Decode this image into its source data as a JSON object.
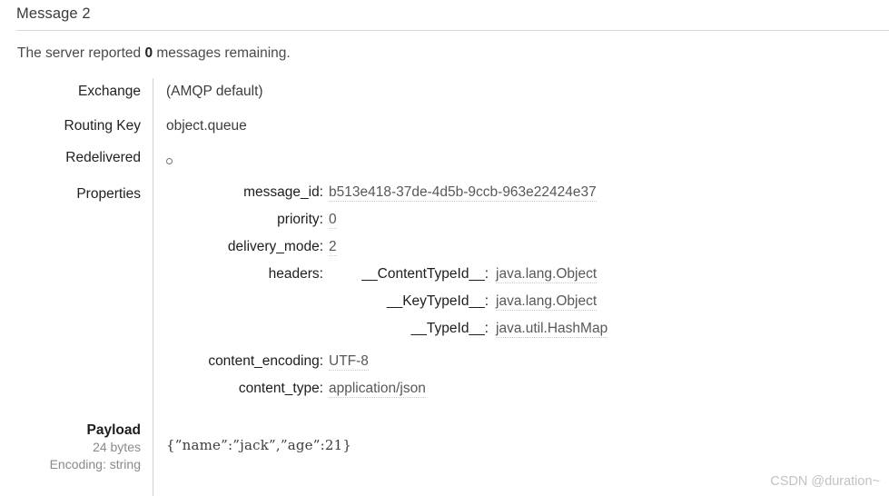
{
  "header": {
    "title": "Message 2"
  },
  "summary": {
    "prefix": "The server reported",
    "count": "0",
    "suffix": "messages remaining."
  },
  "fields": [
    {
      "label": "Exchange",
      "value": "(AMQP default)"
    },
    {
      "label": "Routing Key",
      "value": "object.queue"
    },
    {
      "label": "Redelivered",
      "value": ""
    }
  ],
  "properties": {
    "label": "Properties",
    "items": [
      {
        "key": "message_id:",
        "value": "b513e418-37de-4d5b-9ccb-963e22424e37"
      },
      {
        "key": "priority:",
        "value": "0"
      },
      {
        "key": "delivery_mode:",
        "value": "2"
      },
      {
        "key": "headers:",
        "value": ""
      },
      {
        "key": "content_encoding:",
        "value": "UTF-8"
      },
      {
        "key": "content_type:",
        "value": "application/json"
      }
    ],
    "headers": [
      {
        "key": "__ContentTypeId__:",
        "value": "java.lang.Object"
      },
      {
        "key": "__KeyTypeId__:",
        "value": "java.lang.Object"
      },
      {
        "key": "__TypeId__:",
        "value": "java.util.HashMap"
      }
    ]
  },
  "payload": {
    "title": "Payload",
    "size": "24 bytes",
    "encoding": "Encoding: string",
    "body": "{”name”:”jack”,”age”:21}"
  },
  "watermark": {
    "text": "CSDN @duration~"
  },
  "icons": {
    "redelivered": "circle-outline-icon"
  },
  "colors": {
    "rule": "#dadada",
    "divider": "#d3d3d3",
    "label_text": "#222222",
    "value_text": "#3c3c3c",
    "muted_text": "#8a8a8a",
    "watermark": "#c2c2c2"
  }
}
